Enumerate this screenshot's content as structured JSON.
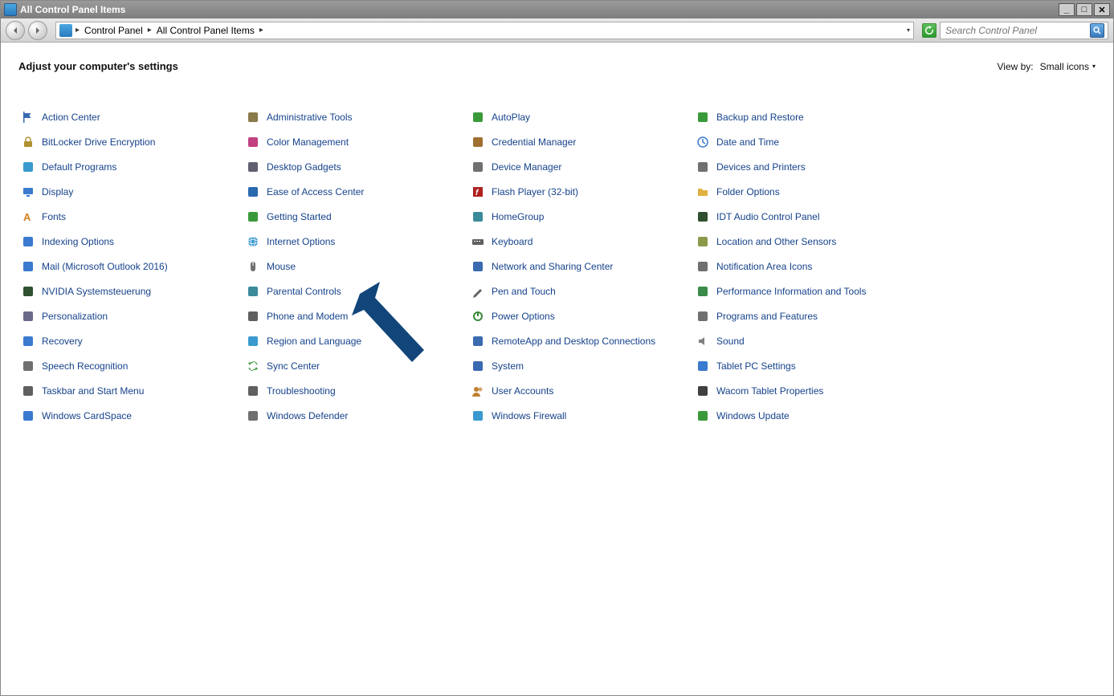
{
  "window": {
    "title": "All Control Panel Items"
  },
  "breadcrumb": {
    "items": [
      "Control Panel",
      "All Control Panel Items"
    ]
  },
  "search": {
    "placeholder": "Search Control Panel"
  },
  "content": {
    "heading": "Adjust your computer's settings",
    "viewby_label": "View by:",
    "viewby_value": "Small icons"
  },
  "items": [
    {
      "label": "Action Center",
      "icon": "flag",
      "c": "#3a6ab0"
    },
    {
      "label": "Administrative Tools",
      "icon": "tools",
      "c": "#8a7a4a"
    },
    {
      "label": "AutoPlay",
      "icon": "autoplay",
      "c": "#3a9a3a"
    },
    {
      "label": "Backup and Restore",
      "icon": "backup",
      "c": "#3a9a3a"
    },
    {
      "label": "BitLocker Drive Encryption",
      "icon": "lock",
      "c": "#b09030"
    },
    {
      "label": "Color Management",
      "icon": "color",
      "c": "#c04080"
    },
    {
      "label": "Credential Manager",
      "icon": "safe",
      "c": "#a07030"
    },
    {
      "label": "Date and Time",
      "icon": "clock",
      "c": "#3a7acf"
    },
    {
      "label": "Default Programs",
      "icon": "programs",
      "c": "#3a9acf"
    },
    {
      "label": "Desktop Gadgets",
      "icon": "gadgets",
      "c": "#606070"
    },
    {
      "label": "Device Manager",
      "icon": "device",
      "c": "#707070"
    },
    {
      "label": "Devices and Printers",
      "icon": "printer",
      "c": "#707070"
    },
    {
      "label": "Display",
      "icon": "display",
      "c": "#3a7acf"
    },
    {
      "label": "Ease of Access Center",
      "icon": "ease",
      "c": "#2a6aaf"
    },
    {
      "label": "Flash Player (32-bit)",
      "icon": "flash",
      "c": "#b02020"
    },
    {
      "label": "Folder Options",
      "icon": "folder",
      "c": "#e0b040"
    },
    {
      "label": "Fonts",
      "icon": "fonts",
      "c": "#d08020"
    },
    {
      "label": "Getting Started",
      "icon": "start",
      "c": "#3a9a3a"
    },
    {
      "label": "HomeGroup",
      "icon": "homegroup",
      "c": "#3a8a9a"
    },
    {
      "label": "IDT Audio Control Panel",
      "icon": "audio",
      "c": "#305030"
    },
    {
      "label": "Indexing Options",
      "icon": "index",
      "c": "#3a7acf"
    },
    {
      "label": "Internet Options",
      "icon": "internet",
      "c": "#3a9acf"
    },
    {
      "label": "Keyboard",
      "icon": "keyboard",
      "c": "#606060"
    },
    {
      "label": "Location and Other Sensors",
      "icon": "location",
      "c": "#8a9a4a"
    },
    {
      "label": "Mail (Microsoft Outlook 2016)",
      "icon": "mail",
      "c": "#3a7acf"
    },
    {
      "label": "Mouse",
      "icon": "mouse",
      "c": "#707070"
    },
    {
      "label": "Network and Sharing Center",
      "icon": "network",
      "c": "#3a6ab0"
    },
    {
      "label": "Notification Area Icons",
      "icon": "notif",
      "c": "#707070"
    },
    {
      "label": "NVIDIA Systemsteuerung",
      "icon": "nvidia",
      "c": "#305030"
    },
    {
      "label": "Parental Controls",
      "icon": "parental",
      "c": "#3a8a9a"
    },
    {
      "label": "Pen and Touch",
      "icon": "pen",
      "c": "#606060"
    },
    {
      "label": "Performance Information and Tools",
      "icon": "perf",
      "c": "#3a8a4a"
    },
    {
      "label": "Personalization",
      "icon": "personalize",
      "c": "#6a6a8a"
    },
    {
      "label": "Phone and Modem",
      "icon": "phone",
      "c": "#606060"
    },
    {
      "label": "Power Options",
      "icon": "power",
      "c": "#3a8a3a"
    },
    {
      "label": "Programs and Features",
      "icon": "progfeat",
      "c": "#707070"
    },
    {
      "label": "Recovery",
      "icon": "recovery",
      "c": "#3a7acf"
    },
    {
      "label": "Region and Language",
      "icon": "region",
      "c": "#3a9acf"
    },
    {
      "label": "RemoteApp and Desktop Connections",
      "icon": "remote",
      "c": "#3a6ab0"
    },
    {
      "label": "Sound",
      "icon": "sound",
      "c": "#808080"
    },
    {
      "label": "Speech Recognition",
      "icon": "speech",
      "c": "#707070"
    },
    {
      "label": "Sync Center",
      "icon": "sync",
      "c": "#3a9a3a"
    },
    {
      "label": "System",
      "icon": "system",
      "c": "#3a6ab0"
    },
    {
      "label": "Tablet PC Settings",
      "icon": "tablet",
      "c": "#3a7acf"
    },
    {
      "label": "Taskbar and Start Menu",
      "icon": "taskbar",
      "c": "#606060"
    },
    {
      "label": "Troubleshooting",
      "icon": "trouble",
      "c": "#606060"
    },
    {
      "label": "User Accounts",
      "icon": "users",
      "c": "#c08030"
    },
    {
      "label": "Wacom Tablet Properties",
      "icon": "wacom",
      "c": "#404040"
    },
    {
      "label": "Windows CardSpace",
      "icon": "cardspace",
      "c": "#3a7acf"
    },
    {
      "label": "Windows Defender",
      "icon": "defender",
      "c": "#707070"
    },
    {
      "label": "Windows Firewall",
      "icon": "firewall",
      "c": "#3a9acf"
    },
    {
      "label": "Windows Update",
      "icon": "update",
      "c": "#3a9a3a"
    }
  ]
}
